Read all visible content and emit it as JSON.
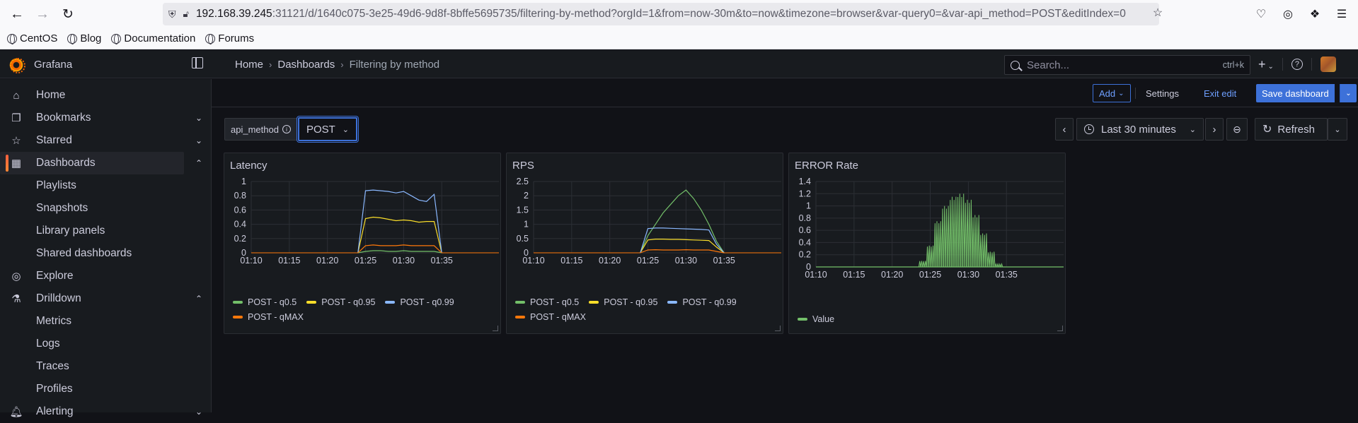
{
  "browser": {
    "url_host": "192.168.39.245",
    "url_rest": ":31121/d/1640c075-3e25-49d6-9d8f-8bffe5695735/filtering-by-method?orgId=1&from=now-30m&to=now&timezone=browser&var-query0=&var-api_method=POST&editIndex=0",
    "bookmarks": [
      "CentOS",
      "Blog",
      "Documentation",
      "Forums"
    ]
  },
  "app": {
    "title": "Grafana",
    "breadcrumb": [
      "Home",
      "Dashboards",
      "Filtering by method"
    ],
    "search_placeholder": "Search...",
    "search_shortcut": "ctrl+k",
    "new_button": "+"
  },
  "sidebar": {
    "items": [
      {
        "label": "Home",
        "icon": "home-icon"
      },
      {
        "label": "Bookmarks",
        "icon": "bookmark-icon"
      },
      {
        "label": "Starred",
        "icon": "star-icon"
      },
      {
        "label": "Dashboards",
        "icon": "apps-icon"
      },
      {
        "label": "Playlists"
      },
      {
        "label": "Snapshots"
      },
      {
        "label": "Library panels"
      },
      {
        "label": "Shared dashboards"
      },
      {
        "label": "Explore",
        "icon": "compass-icon"
      },
      {
        "label": "Drilldown",
        "icon": "drilldown-icon"
      },
      {
        "label": "Metrics"
      },
      {
        "label": "Logs"
      },
      {
        "label": "Traces"
      },
      {
        "label": "Profiles"
      },
      {
        "label": "Alerting",
        "icon": "bell-icon"
      }
    ]
  },
  "toolbar": {
    "add_label": "Add",
    "settings_label": "Settings",
    "exit_edit_label": "Exit edit",
    "save_label": "Save dashboard"
  },
  "variables": {
    "name": "api_method",
    "value": "POST"
  },
  "time_picker": {
    "range_label": "Last 30 minutes",
    "refresh_label": "Refresh"
  },
  "colors": {
    "q05": "#73bf69",
    "q095": "#fade2a",
    "q099": "#8ab8ff",
    "qmax": "#ff780a",
    "value": "#73bf69",
    "accent": "#3d71d9"
  },
  "panels": [
    {
      "title": "Latency",
      "legend": [
        "POST - q0.5",
        "POST - q0.95",
        "POST - q0.99",
        "POST - qMAX"
      ]
    },
    {
      "title": "RPS",
      "legend": [
        "POST - q0.5",
        "POST - q0.95",
        "POST - q0.99",
        "POST - qMAX"
      ]
    },
    {
      "title": "ERROR Rate",
      "legend": [
        "Value"
      ]
    }
  ],
  "chart_data": [
    {
      "type": "line",
      "title": "Latency",
      "x_ticks": [
        "01:10",
        "01:15",
        "01:20",
        "01:25",
        "01:30",
        "01:35"
      ],
      "y_ticks": [
        "0",
        "0.2",
        "0.4",
        "0.6",
        "0.8",
        "1"
      ],
      "ylim": [
        0,
        1
      ],
      "x": [
        "01:24",
        "01:25",
        "01:26",
        "01:27",
        "01:28",
        "01:29",
        "01:30",
        "01:31",
        "01:32",
        "01:33",
        "01:34",
        "01:35"
      ],
      "series": [
        {
          "name": "POST - q0.5",
          "values": [
            0.0,
            0.02,
            0.03,
            0.03,
            0.02,
            0.02,
            0.03,
            0.02,
            0.02,
            0.02,
            0.02,
            0.0
          ]
        },
        {
          "name": "POST - q0.95",
          "values": [
            0.0,
            0.48,
            0.5,
            0.49,
            0.47,
            0.45,
            0.46,
            0.45,
            0.43,
            0.44,
            0.44,
            0.0
          ]
        },
        {
          "name": "POST - q0.99",
          "values": [
            0.0,
            0.87,
            0.88,
            0.87,
            0.86,
            0.84,
            0.86,
            0.8,
            0.74,
            0.72,
            0.82,
            0.0
          ]
        },
        {
          "name": "POST - qMAX",
          "values": [
            0.0,
            0.1,
            0.11,
            0.1,
            0.1,
            0.1,
            0.11,
            0.1,
            0.1,
            0.1,
            0.1,
            0.0
          ]
        }
      ]
    },
    {
      "type": "line",
      "title": "RPS",
      "x_ticks": [
        "01:10",
        "01:15",
        "01:20",
        "01:25",
        "01:30",
        "01:35"
      ],
      "y_ticks": [
        "0",
        "0.5",
        "1",
        "1.5",
        "2",
        "2.5"
      ],
      "ylim": [
        0,
        2.5
      ],
      "x": [
        "01:24",
        "01:25",
        "01:26",
        "01:27",
        "01:28",
        "01:29",
        "01:30",
        "01:31",
        "01:32",
        "01:33",
        "01:34",
        "01:35"
      ],
      "series": [
        {
          "name": "POST - q0.5",
          "values": [
            0.0,
            0.6,
            1.0,
            1.4,
            1.7,
            2.0,
            2.2,
            1.9,
            1.5,
            1.0,
            0.4,
            0.0
          ]
        },
        {
          "name": "POST - q0.95",
          "values": [
            0.0,
            0.45,
            0.48,
            0.48,
            0.47,
            0.47,
            0.46,
            0.45,
            0.44,
            0.43,
            0.2,
            0.0
          ]
        },
        {
          "name": "POST - q0.99",
          "values": [
            0.0,
            0.85,
            0.87,
            0.87,
            0.86,
            0.85,
            0.84,
            0.83,
            0.82,
            0.8,
            0.3,
            0.0
          ]
        },
        {
          "name": "POST - qMAX",
          "values": [
            0.0,
            0.1,
            0.11,
            0.1,
            0.1,
            0.1,
            0.11,
            0.1,
            0.1,
            0.1,
            0.05,
            0.0
          ]
        }
      ]
    },
    {
      "type": "area",
      "title": "ERROR Rate",
      "x_ticks": [
        "01:10",
        "01:15",
        "01:20",
        "01:25",
        "01:30",
        "01:35"
      ],
      "y_ticks": [
        "0",
        "0.2",
        "0.4",
        "0.6",
        "0.8",
        "1",
        "1.2",
        "1.4"
      ],
      "ylim": [
        0,
        1.4
      ],
      "x": [
        "01:24",
        "01:25",
        "01:26",
        "01:27",
        "01:28",
        "01:29",
        "01:30",
        "01:31",
        "01:32",
        "01:33",
        "01:34"
      ],
      "series": [
        {
          "name": "Value",
          "values": [
            0.1,
            0.35,
            0.75,
            1.0,
            1.15,
            1.2,
            1.1,
            0.85,
            0.55,
            0.25,
            0.05
          ]
        }
      ]
    }
  ]
}
